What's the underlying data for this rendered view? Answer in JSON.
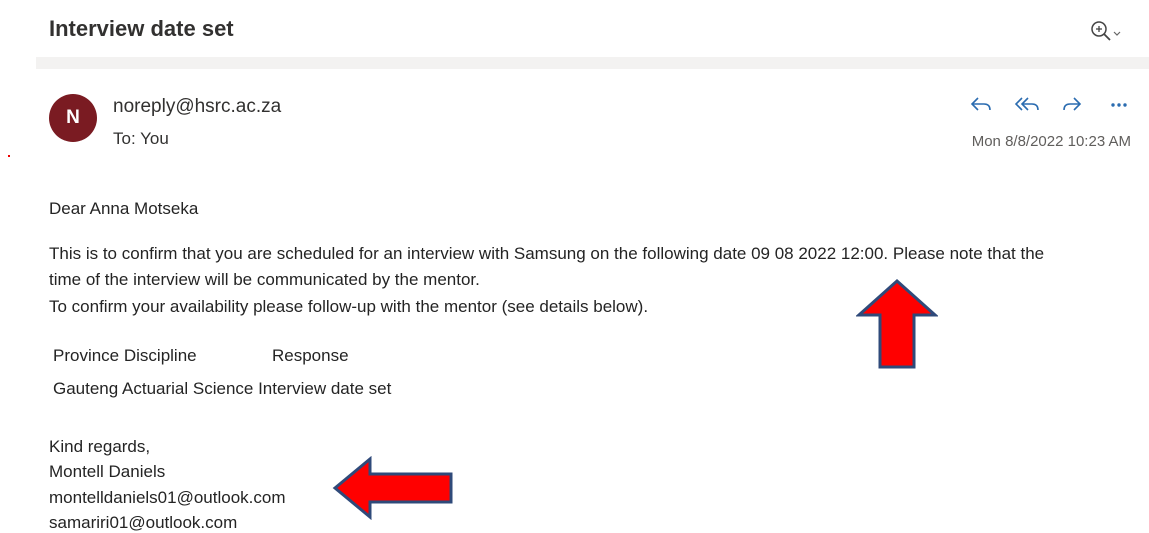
{
  "email": {
    "subject": "Interview date set",
    "sender_initial": "N",
    "sender": "noreply@hsrc.ac.za",
    "to_line": "To:  You",
    "timestamp": "Mon 8/8/2022 10:23 AM",
    "actions": [
      "reply-icon",
      "reply-all-icon",
      "forward-icon",
      "more-icon"
    ],
    "zoom_icon": "zoom-in-icon",
    "avatar_color": "#7a1b22"
  },
  "body": {
    "greeting": "Dear Anna Motseka",
    "paragraph_line1": "This is to confirm that you are scheduled for an interview with Samsung on the following date 09 08 2022 12:00. Please note that the",
    "paragraph_line2": "time of the interview will be communicated by the mentor.",
    "paragraph_line3": "To confirm your availability please follow-up with the mentor (see details below).",
    "table": {
      "header": "Province Discipline",
      "header_response": "Response",
      "row": "Gauteng Actuarial Science Interview date set"
    },
    "closing": "Kind regards,",
    "signature_name": "Montell Daniels",
    "signature_email1": "montelldaniels01@outlook.com",
    "signature_email2": "samariri01@outlook.com"
  },
  "annotations": {
    "arrow_color": "#ff0000",
    "arrow_outline": "#2f4a7a"
  }
}
